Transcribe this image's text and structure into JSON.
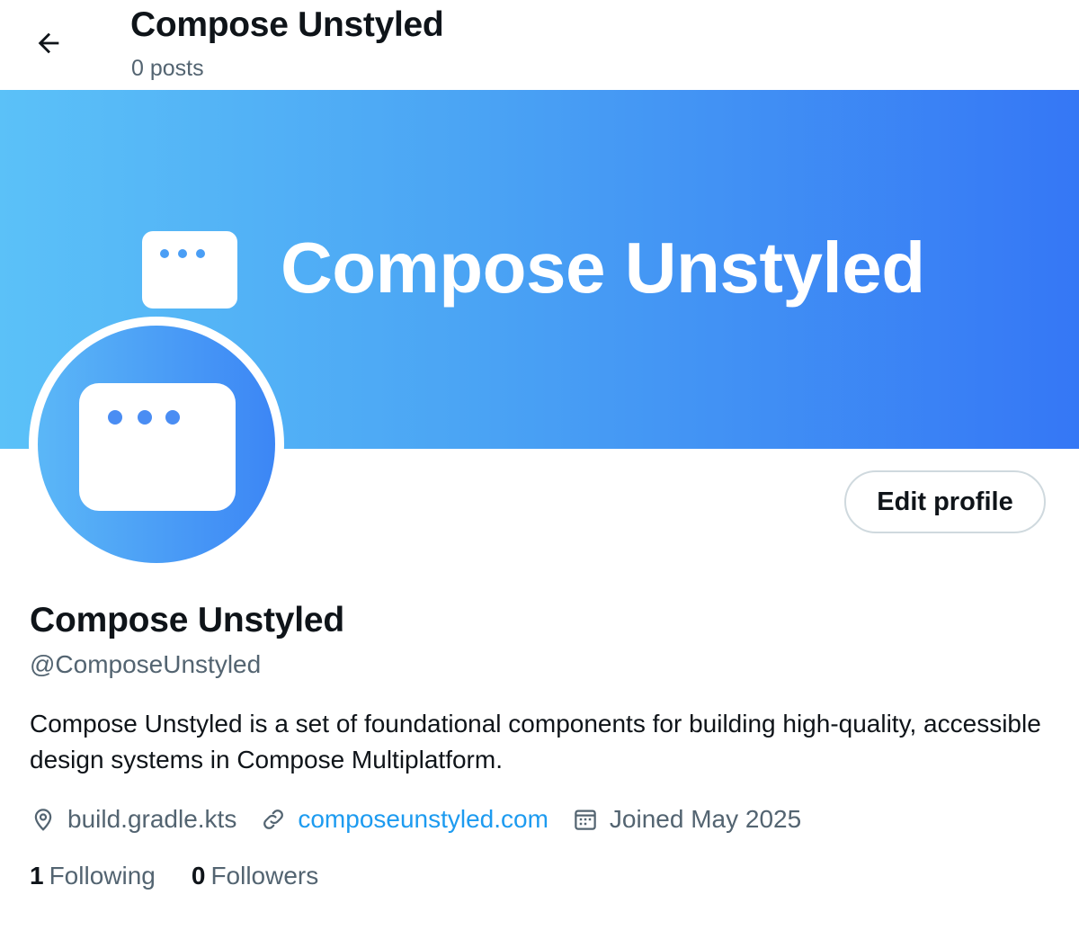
{
  "header": {
    "title": "Compose Unstyled",
    "subtitle": "0 posts",
    "back_icon": "arrow-left-icon"
  },
  "banner": {
    "text": "Compose Unstyled",
    "gradient": [
      "#5bc1f8",
      "#3577f5"
    ],
    "logo_icon": "window-dots-icon"
  },
  "profile": {
    "avatar_icon": "window-dots-icon",
    "edit_button": "Edit profile",
    "name": "Compose Unstyled",
    "handle": "@ComposeUnstyled",
    "bio": "Compose Unstyled is a set of foundational components for building high-quality, accessible design systems in Compose Multiplatform."
  },
  "meta": {
    "location": "build.gradle.kts",
    "location_icon": "location-pin-icon",
    "website": "composeunstyled.com",
    "website_icon": "link-icon",
    "joined": "Joined May 2025",
    "joined_icon": "calendar-icon"
  },
  "stats": {
    "following_count": "1",
    "following_label": "Following",
    "followers_count": "0",
    "followers_label": "Followers"
  },
  "colors": {
    "text_primary": "#0f1419",
    "text_secondary": "#536471",
    "link": "#1d9bf0",
    "border": "#cfd9de"
  }
}
